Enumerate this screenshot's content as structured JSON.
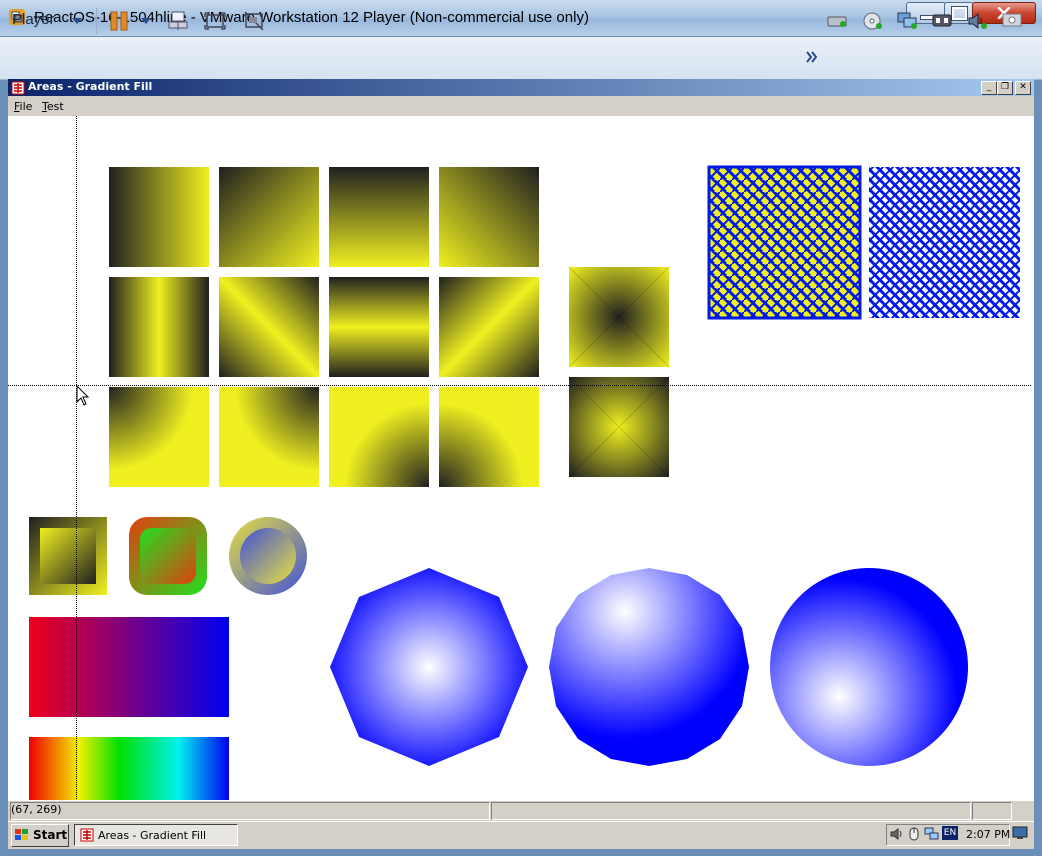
{
  "host": {
    "title": "ReactOS-16-1504hline - VMware Workstation 12 Player (Non-commercial use only)",
    "player_menu_label": "Player",
    "window_buttons": {
      "minimize": "—",
      "maximize": "□",
      "close": "✕"
    },
    "toolbar_icons": [
      "pause-icon",
      "send-ctrl-alt-del-icon",
      "fit-guest-icon",
      "unity-icon"
    ],
    "device_icons": [
      "more-devices-icon",
      "hard-disk-icon",
      "cd-dvd-icon",
      "network-adapter-icon",
      "usb-icon",
      "sound-card-icon",
      "display-icon"
    ]
  },
  "child_window": {
    "title": "Areas - Gradient Fill",
    "buttons": {
      "minimize": "_",
      "restore": "❐",
      "close": "✕"
    }
  },
  "menu": {
    "file": {
      "accel": "F",
      "rest": "ile"
    },
    "test": {
      "accel": "T",
      "rest": "est"
    }
  },
  "statusbar": {
    "coords": "(67, 269)"
  },
  "taskbar": {
    "start_label": "Start",
    "task_label": "Areas - Gradient Fill",
    "clock": "2:07 PM",
    "language": "EN"
  },
  "colors": {
    "yellow": "#f0f020",
    "dark": "#202020",
    "pattern_blue": "#0018e8",
    "rect_red": "#f0001a",
    "rect_blue": "#0000f0",
    "orb_blue": "#0000ff"
  }
}
